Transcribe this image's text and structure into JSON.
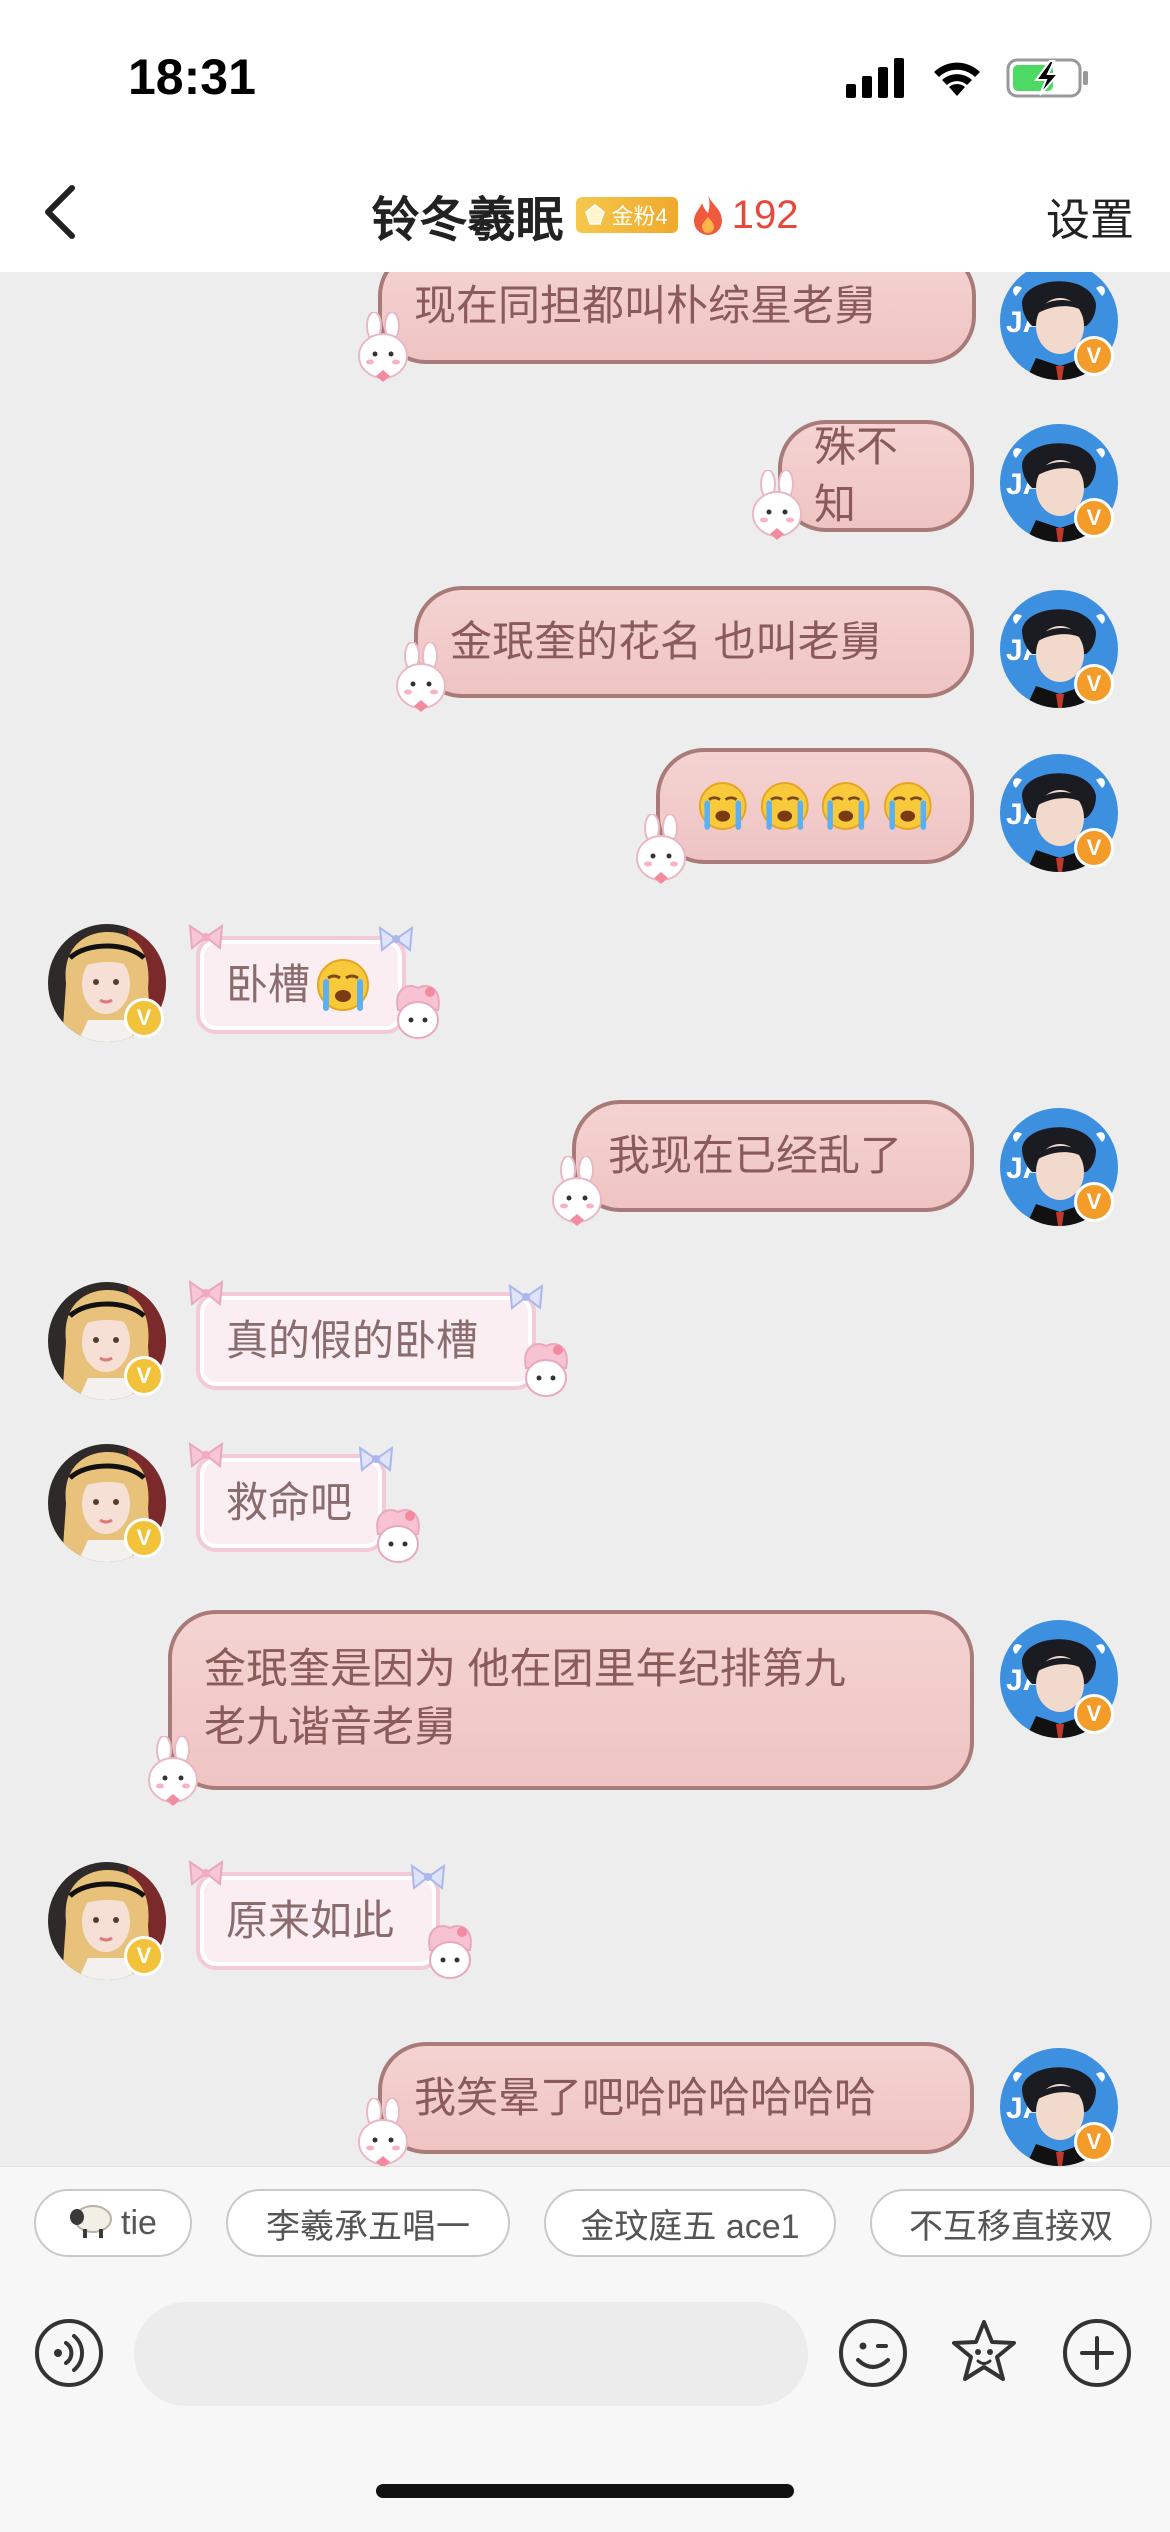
{
  "status_bar": {
    "time": "18:31"
  },
  "nav": {
    "title": "铃冬羲眠",
    "fan_badge": "金粉4",
    "fire_count": "192",
    "settings_label": "设置"
  },
  "messages": [
    {
      "side": "right",
      "text": "现在同担都叫朴综星老舅"
    },
    {
      "side": "right",
      "text": "殊不知"
    },
    {
      "side": "right",
      "text": "金珉奎的花名 也叫老舅"
    },
    {
      "side": "right",
      "text": "",
      "emoji": [
        "crying-face",
        "crying-face",
        "crying-face",
        "crying-face"
      ]
    },
    {
      "side": "left",
      "text": "卧槽",
      "emoji": [
        "crying-face"
      ]
    },
    {
      "side": "right",
      "text": "我现在已经乱了"
    },
    {
      "side": "left",
      "text": "真的假的卧槽"
    },
    {
      "side": "left",
      "text": "救命吧"
    },
    {
      "side": "right",
      "text_line1": "金珉奎是因为 他在团里年纪排第九",
      "text_line2": "老九谐音老舅"
    },
    {
      "side": "left",
      "text": "原来如此"
    },
    {
      "side": "right",
      "text": "我笑晕了吧哈哈哈哈哈哈"
    }
  ],
  "quick_tags": [
    {
      "label": "tie",
      "icon": "sheep-emoji"
    },
    {
      "label": "李羲承五唱一"
    },
    {
      "label": "金玟庭五 ace1"
    },
    {
      "label": "不互移直接双"
    }
  ],
  "input": {
    "placeholder": "",
    "value": ""
  },
  "colors": {
    "accent_red": "#e5493b",
    "badge_gold": "#f2b23a",
    "verified_orange": "#f39c2a",
    "bubble_right_bg": "#f2cccb",
    "bubble_left_bg": "#fbeef3"
  }
}
